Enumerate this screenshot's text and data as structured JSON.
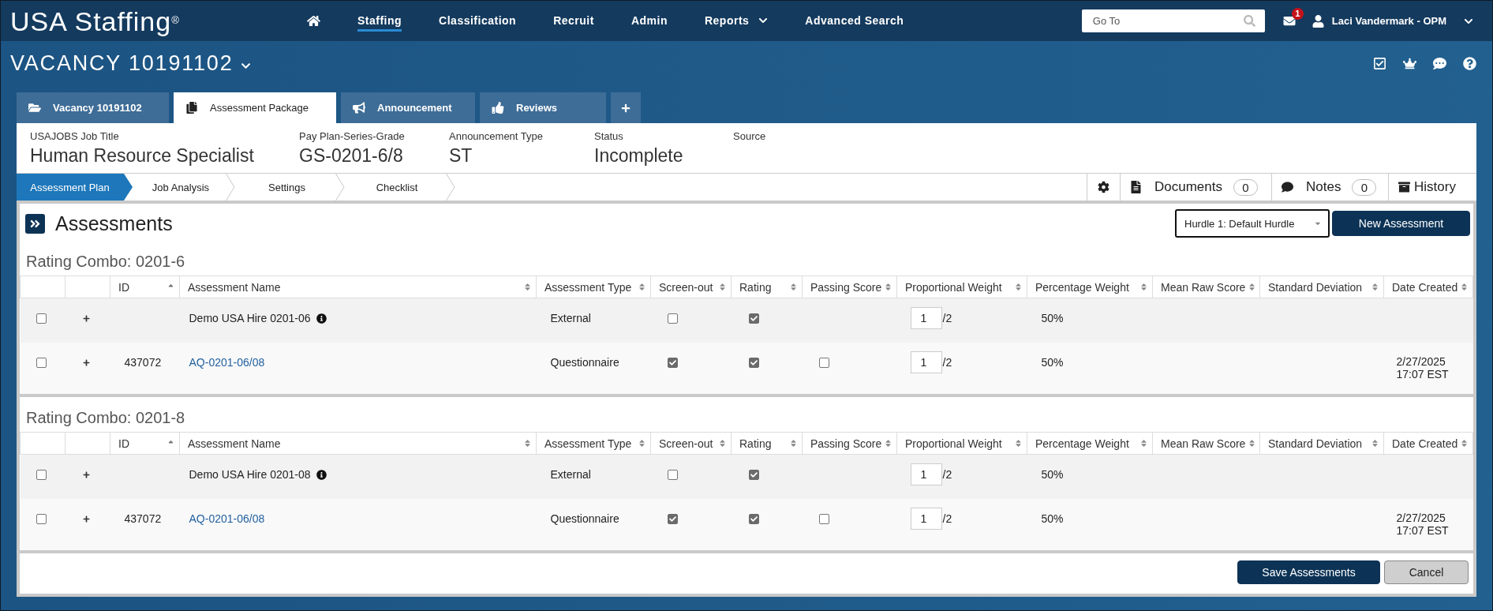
{
  "top_nav": {
    "logo": "USA Staffing$^{®}$",
    "items": [
      {
        "label": "Staffing",
        "selected": true,
        "has_menu": false
      },
      {
        "label": "Classification",
        "selected": false,
        "has_menu": false
      },
      {
        "label": "Recruit",
        "selected": false,
        "has_menu": false
      },
      {
        "label": "Admin",
        "selected": false,
        "has_menu": false
      },
      {
        "label": "Reports",
        "selected": false,
        "has_menu": true
      },
      {
        "label": "Advanced Search",
        "selected": false,
        "has_menu": false
      }
    ],
    "search": {
      "placeholder": "Go To"
    },
    "messages": {
      "badge": "1"
    },
    "user": {
      "name": "Laci Vandermark - OPM"
    }
  },
  "vacancy": {
    "title": "VACANCY 10191102"
  },
  "tabs": [
    {
      "label": "Vacancy 10191102",
      "selected": false
    },
    {
      "label": "Assessment Package",
      "selected": true
    },
    {
      "label": "Announcement",
      "selected": false
    },
    {
      "label": "Reviews",
      "selected": false
    }
  ],
  "summary": [
    {
      "label": "USAJOBS Job Title",
      "value": "Human Resource Specialist"
    },
    {
      "label": "Pay Plan-Series-Grade",
      "value": "GS-0201-6/8"
    },
    {
      "label": "Announcement Type",
      "value": "ST"
    },
    {
      "label": "Status",
      "value": "Incomplete"
    },
    {
      "label": "Source"
    }
  ],
  "steps": [
    {
      "label": "Assessment Plan",
      "selected": true
    },
    {
      "label": "Job Analysis",
      "selected": false
    },
    {
      "label": "Settings",
      "selected": false
    },
    {
      "label": "Checklist",
      "selected": false
    }
  ],
  "toolbar": {
    "documents": {
      "label": "Documents",
      "count": "0"
    },
    "notes": {
      "label": "Notes",
      "count": "0"
    },
    "history": {
      "label": "History"
    }
  },
  "assessments": {
    "title": "Assessments",
    "hurdle": {
      "value": "Hurdle 1: Default Hurdle"
    },
    "new_button": "New Assessment",
    "groups": [
      {
        "title": "Rating Combo: 0201-6",
        "columns": [
          {
            "label": "ID",
            "sorted": true
          },
          {
            "label": "Assessment Name",
            "sorted": false
          },
          {
            "label": "Assessment Type",
            "sorted": false
          },
          {
            "label": "Screen-out",
            "sorted": false
          },
          {
            "label": "Rating",
            "sorted": false
          },
          {
            "label": "Passing Score",
            "sorted": false
          },
          {
            "label": "Proportional Weight",
            "sorted": false
          },
          {
            "label": "Percentage Weight",
            "sorted": false
          },
          {
            "label": "Mean Raw Score",
            "sorted": false
          },
          {
            "label": "Standard Deviation",
            "sorted": false
          },
          {
            "label": "Date Created",
            "sorted": false
          }
        ],
        "rows": [
          {
            "checked": false,
            "expanded": false,
            "name": "Demo USA Hire 0201-06",
            "link": false,
            "info": true,
            "type": "External",
            "screen_out": false,
            "rating": true,
            "weight": "1",
            "weight_total": "/2",
            "percentage": "50%"
          },
          {
            "checked": false,
            "expanded": false,
            "id": "437072",
            "name": "AQ-0201-06/08",
            "link": true,
            "info": false,
            "type": "Questionnaire",
            "screen_out": true,
            "rating": true,
            "passing_score": false,
            "weight": "1",
            "weight_total": "/2",
            "percentage": "50%",
            "date_created": "2/27/2025 17:07 EST"
          }
        ]
      },
      {
        "title": "Rating Combo: 0201-8",
        "columns": [
          {
            "label": "ID",
            "sorted": true
          },
          {
            "label": "Assessment Name",
            "sorted": false
          },
          {
            "label": "Assessment Type",
            "sorted": false
          },
          {
            "label": "Screen-out",
            "sorted": false
          },
          {
            "label": "Rating",
            "sorted": false
          },
          {
            "label": "Passing Score",
            "sorted": false
          },
          {
            "label": "Proportional Weight",
            "sorted": false
          },
          {
            "label": "Percentage Weight",
            "sorted": false
          },
          {
            "label": "Mean Raw Score",
            "sorted": false
          },
          {
            "label": "Standard Deviation",
            "sorted": false
          },
          {
            "label": "Date Created",
            "sorted": false
          }
        ],
        "rows": [
          {
            "checked": false,
            "expanded": false,
            "name": "Demo USA Hire 0201-08",
            "link": false,
            "info": true,
            "type": "External",
            "screen_out": false,
            "rating": true,
            "weight": "1",
            "weight_total": "/2",
            "percentage": "50%"
          },
          {
            "checked": false,
            "expanded": false,
            "id": "437072",
            "name": "AQ-0201-06/08",
            "link": true,
            "info": false,
            "type": "Questionnaire",
            "screen_out": true,
            "rating": true,
            "passing_score": false,
            "weight": "1",
            "weight_total": "/2",
            "percentage": "50%",
            "date_created": "2/27/2025 17:07 EST"
          }
        ]
      }
    ]
  },
  "footer": {
    "buttons": [
      {
        "label": "Save Assessments",
        "kind": "primary"
      },
      {
        "label": "Cancel",
        "kind": "secondary"
      }
    ]
  }
}
